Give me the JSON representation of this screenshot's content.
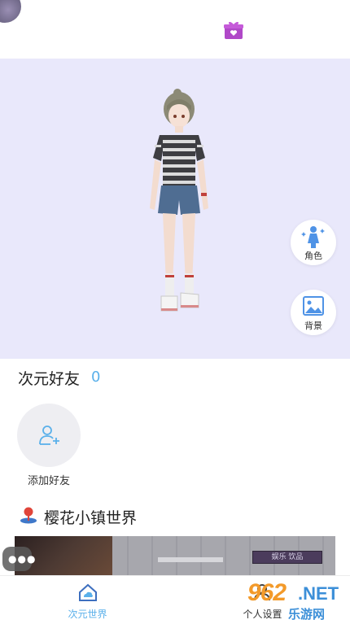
{
  "top": {
    "gift_icon": "gift-icon",
    "gift_color": "#b048c8"
  },
  "stage": {
    "background": "#e9e8fb",
    "buttons": [
      {
        "label": "角色",
        "icon": "character-figure-icon"
      },
      {
        "label": "背景",
        "icon": "image-icon"
      }
    ]
  },
  "friends": {
    "title": "次元好友",
    "count": "0",
    "add_label": "添加好友"
  },
  "world": {
    "title": "樱花小镇世界",
    "icon": "map-pin-icon",
    "banner_sign": "娱乐  饮品"
  },
  "chat": {
    "icon": "chat-bubble-icon"
  },
  "tabbar": {
    "tabs": [
      {
        "label": "次元世界",
        "icon": "home-cloud-icon",
        "active": true
      },
      {
        "label": "个人设置",
        "icon": "person-settings-icon",
        "active": false
      }
    ],
    "accent": "#5ab0ea"
  },
  "watermark": {
    "number": "962",
    "suffix": ".NET",
    "site": "乐游网"
  }
}
